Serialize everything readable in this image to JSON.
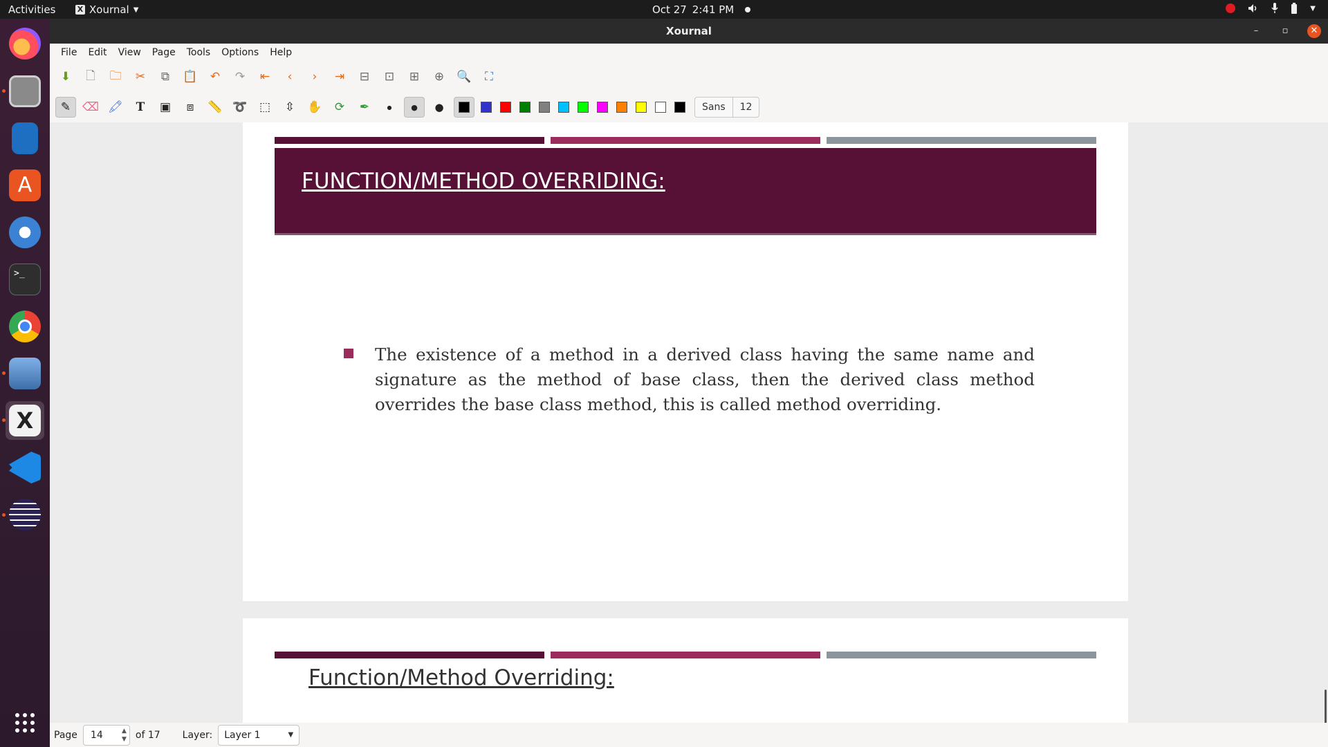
{
  "topbar": {
    "activities": "Activities",
    "app_name": "Xournal",
    "date": "Oct 27",
    "time": "2:41 PM"
  },
  "dock": {
    "items": [
      {
        "name": "Firefox",
        "color": "#ff7139"
      },
      {
        "name": "Files",
        "color": "#7b7b7b"
      },
      {
        "name": "LibreOffice Writer",
        "color": "#2a7ac9"
      },
      {
        "name": "Ubuntu Software",
        "color": "#e95420"
      },
      {
        "name": "Thunderbird",
        "color": "#2f72c8"
      },
      {
        "name": "Terminal",
        "color": "#2e2e2e"
      },
      {
        "name": "Chrome",
        "color": "#4285f4"
      },
      {
        "name": "Image Viewer",
        "color": "#5a8fcf"
      },
      {
        "name": "Xournal",
        "color": "#efefef"
      },
      {
        "name": "Visual Studio Code",
        "color": "#1e88e5"
      },
      {
        "name": "Eclipse",
        "color": "#2c2255"
      }
    ],
    "apps_grid": "Show Applications"
  },
  "window": {
    "title": "Xournal"
  },
  "menu": [
    "File",
    "Edit",
    "View",
    "Page",
    "Tools",
    "Options",
    "Help"
  ],
  "toolbar": {
    "font_name": "Sans",
    "font_size": "12"
  },
  "colors": [
    "#000000",
    "#3333cc",
    "#ff0000",
    "#008000",
    "#808080",
    "#00c0ff",
    "#00ff00",
    "#ff00ff",
    "#ff8000",
    "#ffff00",
    "#ffffff",
    "#000000"
  ],
  "page1": {
    "title": "FUNCTION/METHOD OVERRIDING:",
    "bullet": "The existence of a method in a derived class having the same name and signature as the method of base class, then the derived class method overrides the base class method, this is called method overriding."
  },
  "page2": {
    "title": "Function/Method Overriding:"
  },
  "status": {
    "page_label": "Page",
    "page_value": "14",
    "page_total": "of 17",
    "layer_label": "Layer:",
    "layer_value": "Layer 1"
  }
}
